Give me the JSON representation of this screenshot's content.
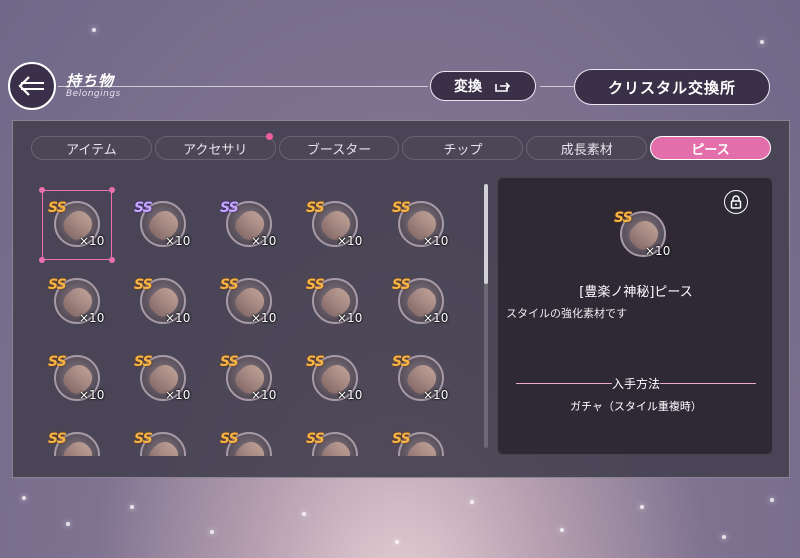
{
  "header": {
    "title": "持ち物",
    "subtitle": "Belongings",
    "back_icon": "arrow-left-icon",
    "exchange_label": "変換",
    "exchange_icon": "export-icon",
    "crystal_exchange_label": "クリスタル交換所"
  },
  "tabs": [
    {
      "label": "アイテム",
      "active": false,
      "notify": false
    },
    {
      "label": "アクセサリ",
      "active": false,
      "notify": true
    },
    {
      "label": "ブースター",
      "active": false,
      "notify": false
    },
    {
      "label": "チップ",
      "active": false,
      "notify": false
    },
    {
      "label": "成長素材",
      "active": false,
      "notify": false
    },
    {
      "label": "ピース",
      "active": true,
      "notify": false
    }
  ],
  "pieces": [
    {
      "rank": "SS",
      "color": "gold",
      "qty": "×10",
      "selected": true
    },
    {
      "rank": "SS",
      "color": "purple",
      "qty": "×10"
    },
    {
      "rank": "SS",
      "color": "purple",
      "qty": "×10"
    },
    {
      "rank": "SS",
      "color": "gold",
      "qty": "×10"
    },
    {
      "rank": "SS",
      "color": "gold",
      "qty": "×10"
    },
    {
      "rank": "SS",
      "color": "gold",
      "qty": "×10"
    },
    {
      "rank": "SS",
      "color": "gold",
      "qty": "×10"
    },
    {
      "rank": "SS",
      "color": "gold",
      "qty": "×10"
    },
    {
      "rank": "SS",
      "color": "gold",
      "qty": "×10"
    },
    {
      "rank": "SS",
      "color": "gold",
      "qty": "×10"
    },
    {
      "rank": "SS",
      "color": "gold",
      "qty": "×10"
    },
    {
      "rank": "SS",
      "color": "gold",
      "qty": "×10"
    },
    {
      "rank": "SS",
      "color": "gold",
      "qty": "×10"
    },
    {
      "rank": "SS",
      "color": "gold",
      "qty": "×10"
    },
    {
      "rank": "SS",
      "color": "gold",
      "qty": "×10"
    },
    {
      "rank": "SS",
      "color": "gold",
      "qty": ""
    },
    {
      "rank": "SS",
      "color": "gold",
      "qty": ""
    },
    {
      "rank": "SS",
      "color": "gold",
      "qty": ""
    },
    {
      "rank": "SS",
      "color": "gold",
      "qty": ""
    },
    {
      "rank": "SS",
      "color": "gold",
      "qty": ""
    }
  ],
  "detail": {
    "rank": "SS",
    "qty": "×10",
    "name": "[豊楽ノ神秘]ピース",
    "description": "スタイルの強化素材です",
    "acquisition_heading": "入手方法",
    "acquisition_method": "ガチャ（スタイル重複時）",
    "lock_icon": "lock-icon"
  },
  "colors": {
    "accent": "#e26fa9",
    "rank_gold": "#f7b545",
    "rank_purple": "#c7a7ff"
  }
}
